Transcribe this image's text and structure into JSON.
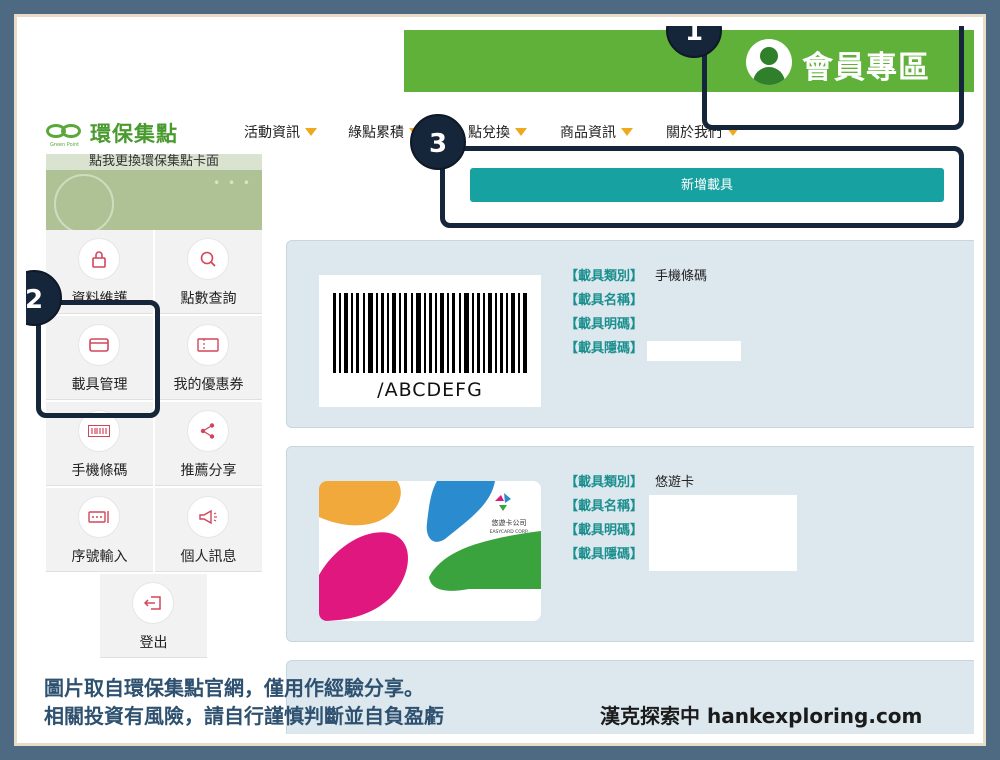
{
  "header": {
    "member_label": "會員專區",
    "logo_text": "環保集點",
    "logo_subtext": "Green Point",
    "nav": [
      "活動資訊",
      "綠點累積",
      "點兌換",
      "商品資訊",
      "關於我們"
    ]
  },
  "sidebar": {
    "card_banner_text": "點我更換環保集點卡面",
    "items": [
      {
        "label": "資料維護",
        "icon": "lock-icon"
      },
      {
        "label": "點數查詢",
        "icon": "search-icon"
      },
      {
        "label": "載具管理",
        "icon": "card-icon"
      },
      {
        "label": "我的優惠券",
        "icon": "ticket-icon"
      },
      {
        "label": "手機條碼",
        "icon": "barcode-icon"
      },
      {
        "label": "推薦分享",
        "icon": "share-icon"
      },
      {
        "label": "序號輸入",
        "icon": "serial-icon"
      },
      {
        "label": "個人訊息",
        "icon": "megaphone-icon"
      },
      {
        "label": "登出",
        "icon": "logout-icon"
      }
    ]
  },
  "main": {
    "add_button": "新增載具",
    "carriers": [
      {
        "type_key": "【載具類別】",
        "type_value": "手機條碼",
        "name_key": "【載具名稱】",
        "visible_key": "【載具明碼】",
        "hidden_key": "【載具隱碼】",
        "barcode_text": "/ABCDEFG"
      },
      {
        "type_key": "【載具類別】",
        "type_value": "悠遊卡",
        "name_key": "【載具名稱】",
        "visible_key": "【載具明碼】",
        "hidden_key": "【載具隱碼】",
        "card_brand": "悠遊卡公司",
        "card_brand_en": "EASYCARD CORP."
      }
    ]
  },
  "markers": [
    "1",
    "2",
    "3"
  ],
  "caption": {
    "line1": "圖片取自環保集點官網，僅用作經驗分享。",
    "line2": "相關投資有風險，請自行謹慎判斷並自負盈虧",
    "brand": "漢克探索中 hankexploring.com"
  },
  "colors": {
    "member_green": "#5fb13a",
    "accent_teal": "#17a1a0",
    "marker_navy": "#15253a",
    "caption_blue": "#2e5170"
  }
}
